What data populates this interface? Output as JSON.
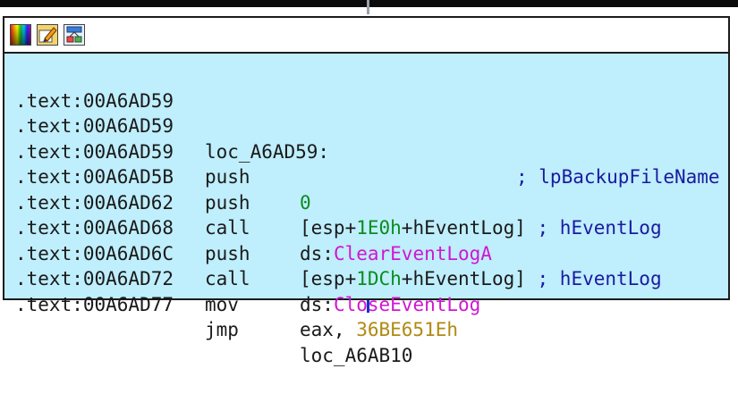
{
  "icons": {
    "colors": "node-color-icon",
    "rename": "edit-icon",
    "graph": "graph-view-icon"
  },
  "code_lines": [
    {
      "addr": ".text:00A6AD59"
    },
    {
      "addr": ".text:00A6AD59",
      "label": "loc_A6AD59:",
      "comment": "; lpBackupFileName"
    },
    {
      "addr": ".text:00A6AD59",
      "mnem": "push",
      "op_num": "0"
    },
    {
      "addr": ".text:00A6AD5B",
      "mnem": "push",
      "op_pre": "[esp+",
      "op_num": "1E0h",
      "op_post": "+hEventLog]",
      "comment": " ; hEventLog"
    },
    {
      "addr": ".text:00A6AD62",
      "mnem": "call",
      "op_pre": "ds:",
      "op_fn": "ClearEventLogA"
    },
    {
      "addr": ".text:00A6AD68",
      "mnem": "push",
      "op_pre": "[esp+",
      "op_num": "1DCh",
      "op_post": "+hEventLog]",
      "comment": " ; hEventLog"
    },
    {
      "addr": ".text:00A6AD6C",
      "mnem": "call",
      "op_pre": "ds:",
      "op_fn": "CloseEventLog"
    },
    {
      "addr": ".text:00A6AD72",
      "mnem": "mov",
      "op_pre": "eax, ",
      "op_hex": "36BE651Eh"
    },
    {
      "addr": ".text:00A6AD77",
      "mnem": "jmp",
      "op_pre": "loc_A6AB10"
    }
  ],
  "colors": {
    "node_bg": "#bfeefc",
    "number": "#0b8c1f",
    "import_name": "#d116d1",
    "hex_constant": "#b08a11",
    "comment": "#1a1aa0"
  }
}
